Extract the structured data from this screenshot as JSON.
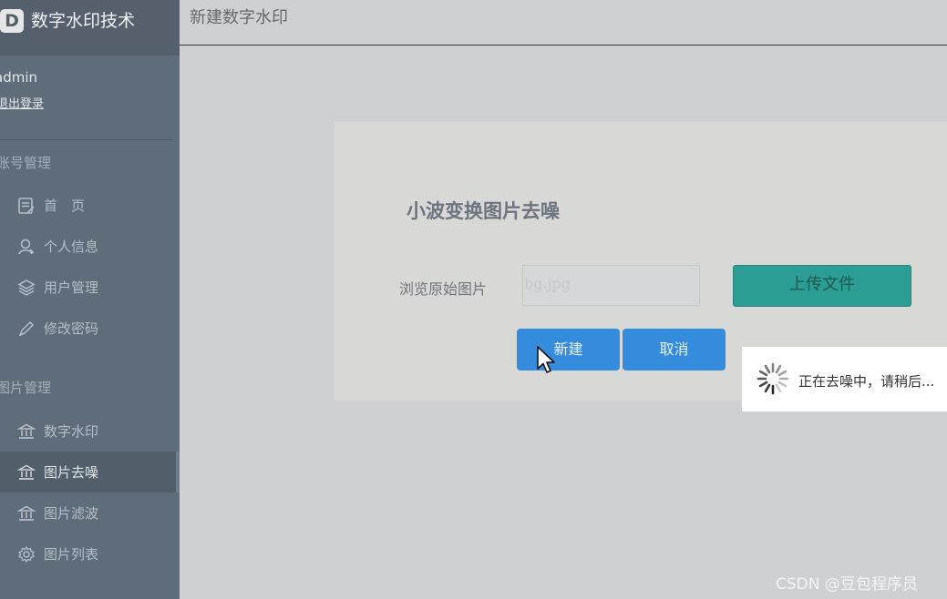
{
  "brand": {
    "logo_letter": "D",
    "title": "数字水印技术"
  },
  "user": {
    "name": "admin",
    "logout_label": "退出登录"
  },
  "sidebar": {
    "sections": [
      {
        "title": "账号管理"
      },
      {
        "title": "图片管理"
      }
    ],
    "items": [
      {
        "label": "首　页",
        "icon": "document-icon"
      },
      {
        "label": "个人信息",
        "icon": "user-icon"
      },
      {
        "label": "用户管理",
        "icon": "layers-icon"
      },
      {
        "label": "修改密码",
        "icon": "pencil-icon"
      },
      {
        "label": "数字水印",
        "icon": "bank-icon"
      },
      {
        "label": "图片去噪",
        "icon": "bank-icon",
        "active": true
      },
      {
        "label": "图片滤波",
        "icon": "bank-icon"
      },
      {
        "label": "图片列表",
        "icon": "gear-icon"
      }
    ]
  },
  "header": {
    "title": "新建数字水印"
  },
  "form": {
    "title": "小波变换图片去噪",
    "file_label": "浏览原始图片",
    "file_value": "bg.jpg",
    "upload_label": "上传文件",
    "submit_label": "新建",
    "cancel_label": "取消"
  },
  "loading": {
    "text": "正在去噪中，请稍后..."
  },
  "watermark": "CSDN @豆包程序员",
  "colors": {
    "sidebar": "#5f6c79",
    "upload_button": "#2b9d93",
    "primary_button": "#358bdc"
  }
}
